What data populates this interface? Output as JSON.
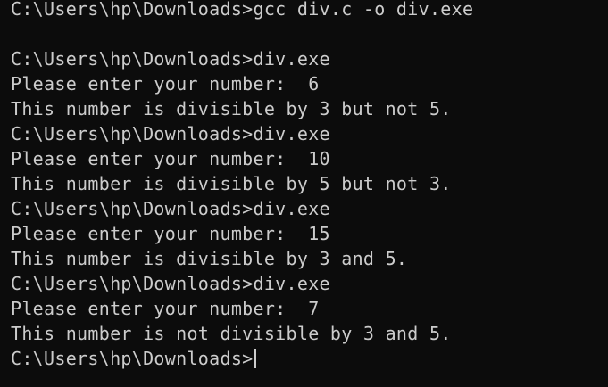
{
  "terminal": {
    "colors": {
      "background": "#0c0c0c",
      "foreground": "#cccccc"
    },
    "lines": [
      "C:\\Users\\hp\\Downloads>gcc div.c -o div.exe",
      "",
      "C:\\Users\\hp\\Downloads>div.exe",
      "Please enter your number:  6",
      "This number is divisible by 3 but not 5.",
      "C:\\Users\\hp\\Downloads>div.exe",
      "Please enter your number:  10",
      "This number is divisible by 5 but not 3.",
      "C:\\Users\\hp\\Downloads>div.exe",
      "Please enter your number:  15",
      "This number is divisible by 3 and 5.",
      "C:\\Users\\hp\\Downloads>div.exe",
      "Please enter your number:  7",
      "This number is not divisible by 3 and 5."
    ],
    "prompt": "C:\\Users\\hp\\Downloads>"
  }
}
